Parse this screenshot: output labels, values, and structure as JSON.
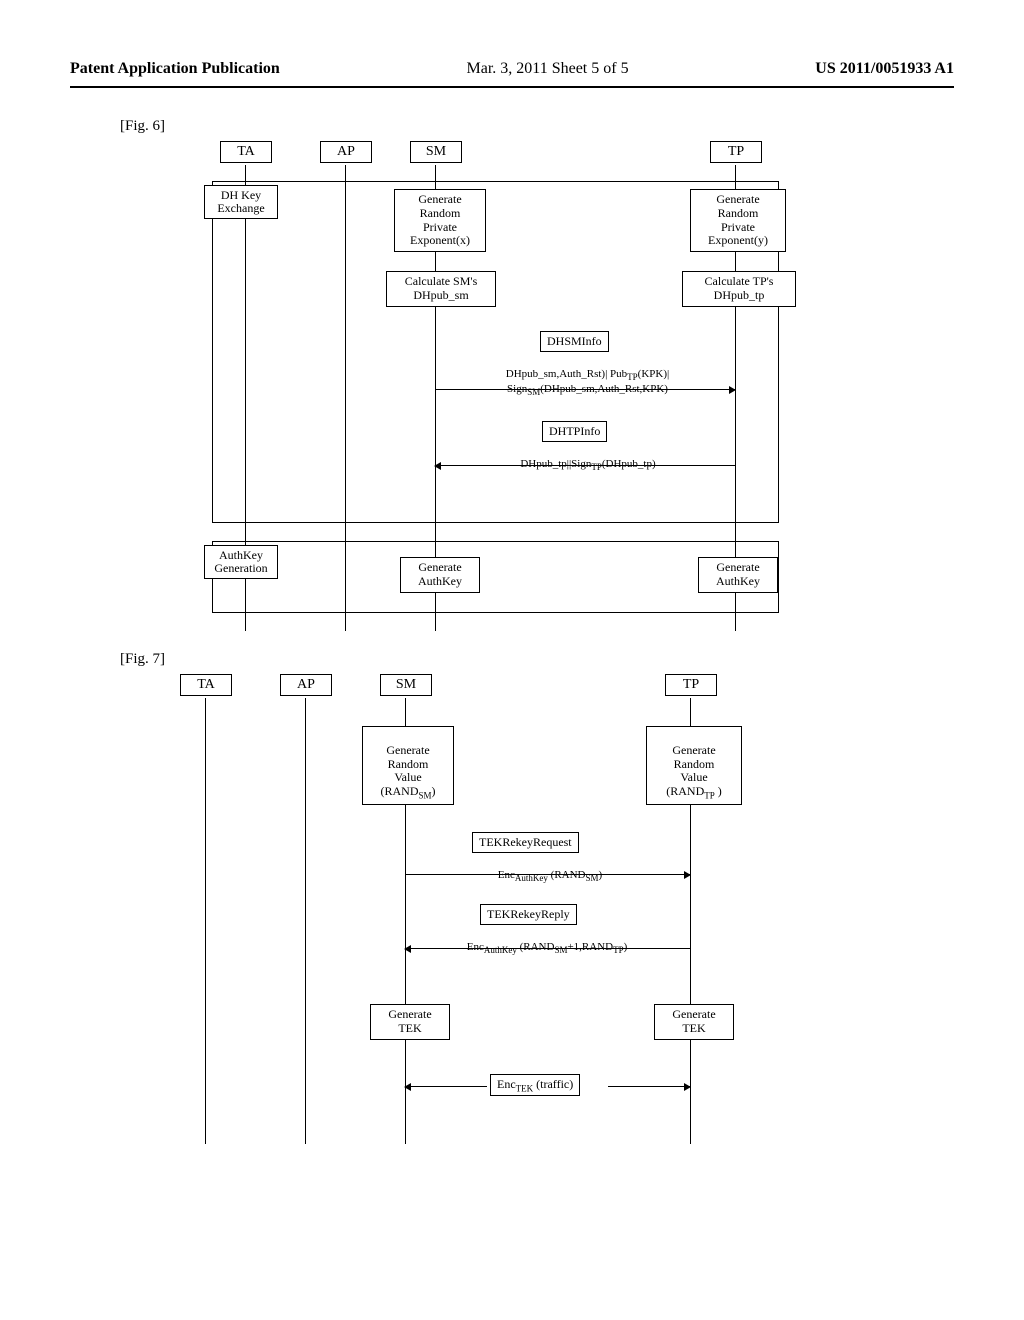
{
  "header": {
    "left": "Patent Application Publication",
    "mid": "Mar. 3, 2011  Sheet 5 of 5",
    "right": "US 2011/0051933 A1"
  },
  "fig6": {
    "label": "[Fig. 6]",
    "actors": {
      "ta": "TA",
      "ap": "AP",
      "sm": "SM",
      "tp": "TP"
    },
    "phase1": "DH Key\nExchange",
    "phase2": "AuthKey\nGeneration",
    "sm_gen_rand": "Generate\nRandom\nPrivate\nExponent(x)",
    "tp_gen_rand": "Generate\nRandom\nPrivate\nExponent(y)",
    "sm_calc": "Calculate SM's\nDHpub_sm",
    "tp_calc": "Calculate TP's\nDHpub_tp",
    "dhsminfo_box": "DHSMInfo",
    "dhsminfo_text": "DHpub_sm,Auth_Rst)| PubTP(KPK)|\nSignSM(DHpub_sm,Auth_Rst,KPK)",
    "dhtpinfo_box": "DHTPInfo",
    "dhtpinfo_text": "DHpub_tp||SignTP(DHpub_tp)",
    "sm_authkey": "Generate\nAuthKey",
    "tp_authkey": "Generate\nAuthKey"
  },
  "fig7": {
    "label": "[Fig. 7]",
    "actors": {
      "ta": "TA",
      "ap": "AP",
      "sm": "SM",
      "tp": "TP"
    },
    "sm_gen_rand": "Generate\nRandom\nValue\n(RANDSM)",
    "tp_gen_rand": "Generate\nRandom\nValue\n(RANDTP )",
    "tek_req_box": "TEKRekeyRequest",
    "tek_req_text": "EncAuthKey (RANDSM)",
    "tek_rep_box": "TEKRekeyReply",
    "tek_rep_text": "EncAuthKey (RANDSM+1,RANDTP)",
    "sm_gen_tek": "Generate\nTEK",
    "tp_gen_tek": "Generate\nTEK",
    "enc_traffic": "EncTEK (traffic)"
  }
}
